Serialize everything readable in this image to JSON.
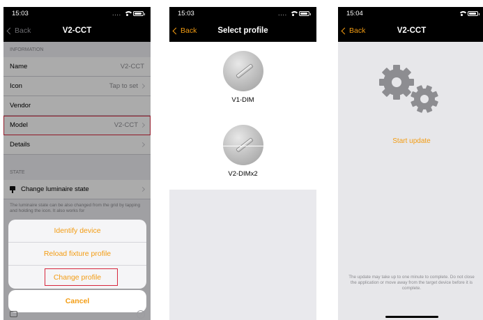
{
  "phone1": {
    "time": "15:03",
    "back_label": "Back",
    "title": "V2-CCT",
    "info_header": "INFORMATION",
    "rows": [
      {
        "label": "Name",
        "value": "V2-CCT"
      },
      {
        "label": "Icon",
        "value": "Tap to set"
      },
      {
        "label": "Vendor",
        "value": ""
      },
      {
        "label": "Model",
        "value": "V2-CCT"
      },
      {
        "label": "Details",
        "value": ""
      }
    ],
    "state_header": "STATE",
    "state_row": "Change luminaire state",
    "state_footer": "The luminaire state can be also changed from the grid by tapping and holding the icon. It also works for",
    "actions": [
      "Identify device",
      "Reload fixture profile",
      "Change profile"
    ],
    "cancel_label": "Cancel",
    "help_glyph": "?"
  },
  "phone2": {
    "time": "15:03",
    "back_label": "Back",
    "title": "Select profile",
    "profiles": [
      "V1-DIM",
      "V2-DIMx2"
    ]
  },
  "phone3": {
    "time": "15:04",
    "back_label": "Back",
    "title": "V2-CCT",
    "start_update_label": "Start update",
    "update_note": "The update may take up to one minute to complete. Do not close the application or move away from the target device before it is complete."
  },
  "colors": {
    "accent": "#f39c12",
    "highlight": "#d7263d",
    "bar": "#000000"
  },
  "icons": [
    "back-chevron-icon",
    "chevron-right-icon",
    "lamp-icon",
    "gears-icon",
    "help-icon",
    "wifi-icon",
    "battery-icon"
  ]
}
